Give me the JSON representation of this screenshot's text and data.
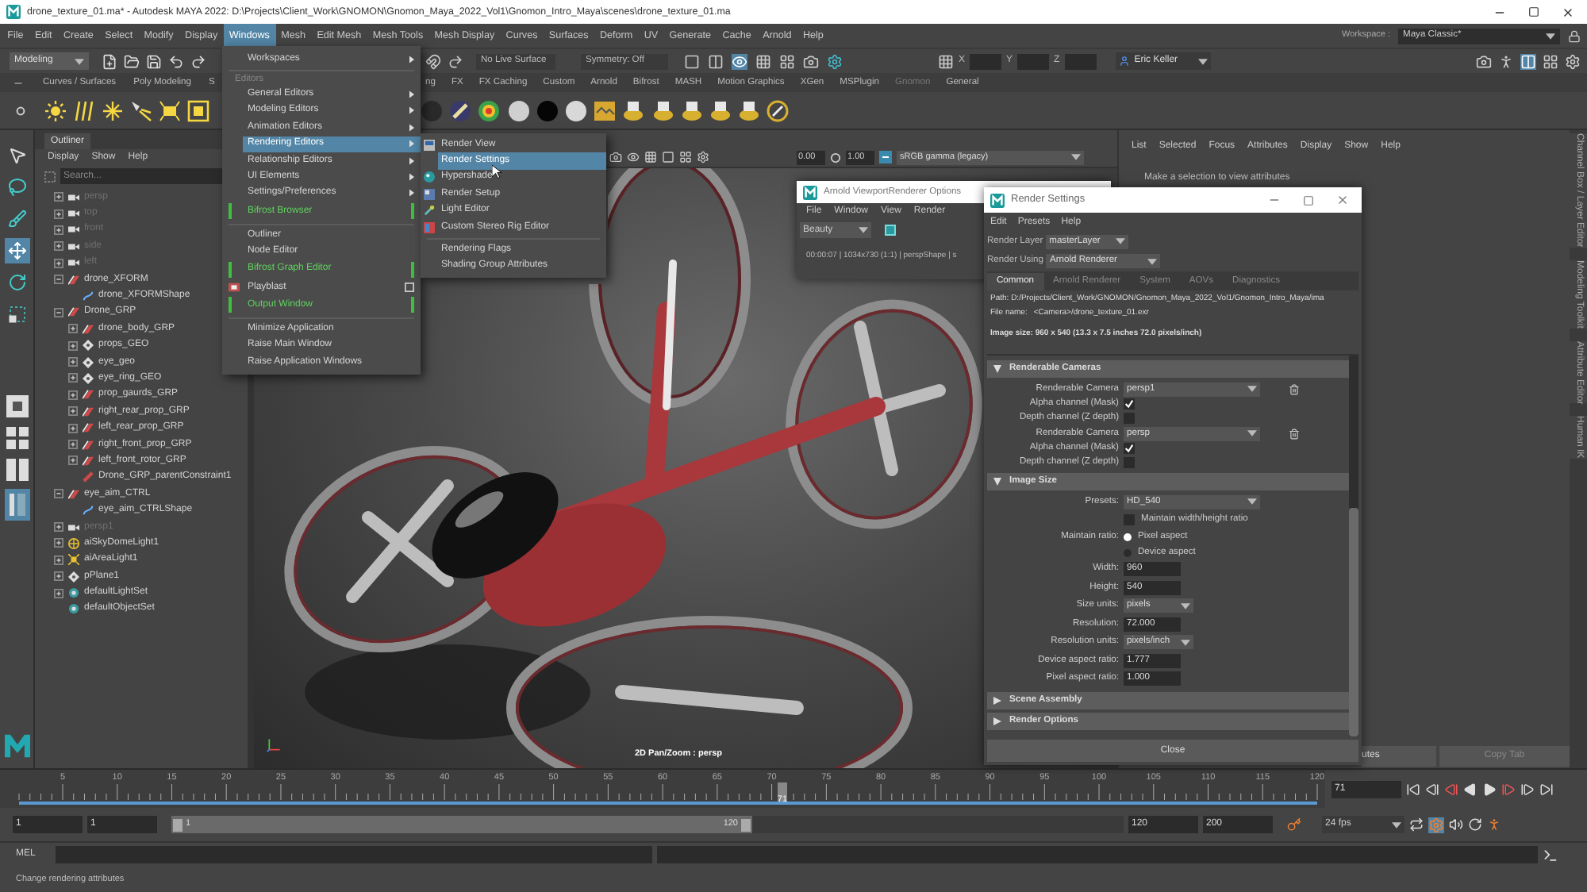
{
  "window": {
    "title": "drone_texture_01.ma* - Autodesk MAYA 2022: D:\\Projects\\Client_Work\\GNOMON\\Gnomon_Maya_2022_Vol1\\Gnomon_Intro_Maya\\scenes\\drone_texture_01.ma"
  },
  "menu_bar": [
    {
      "label": "File",
      "selected": false
    },
    {
      "label": "Edit",
      "selected": false
    },
    {
      "label": "Create",
      "selected": false
    },
    {
      "label": "Select",
      "selected": false
    },
    {
      "label": "Modify",
      "selected": false
    },
    {
      "label": "Display",
      "selected": false
    },
    {
      "label": "Windows",
      "selected": true
    },
    {
      "label": "Mesh",
      "selected": false
    },
    {
      "label": "Edit Mesh",
      "selected": false
    },
    {
      "label": "Mesh Tools",
      "selected": false
    },
    {
      "label": "Mesh Display",
      "selected": false
    },
    {
      "label": "Curves",
      "selected": false
    },
    {
      "label": "Surfaces",
      "selected": false
    },
    {
      "label": "Deform",
      "selected": false
    },
    {
      "label": "UV",
      "selected": false
    },
    {
      "label": "Generate",
      "selected": false
    },
    {
      "label": "Cache",
      "selected": false
    },
    {
      "label": "Arnold",
      "selected": false
    },
    {
      "label": "Help",
      "selected": false
    }
  ],
  "workspace": {
    "label": "Workspace :",
    "value": "Maya Classic*"
  },
  "status_line": {
    "menu_set": "Modeling",
    "live_surface": "No Live Surface",
    "symmetry": "Symmetry: Off",
    "coordinates": [
      "X",
      "Y",
      "Z"
    ],
    "user": "Eric Keller"
  },
  "shelf_tabs": [
    {
      "label": "Curves / Surfaces",
      "disabled": false
    },
    {
      "label": "Poly Modeling",
      "disabled": false
    },
    {
      "label": "S",
      "disabled": false
    },
    {
      "label": "ng",
      "disabled": false
    },
    {
      "label": "FX",
      "disabled": false
    },
    {
      "label": "FX Caching",
      "disabled": false
    },
    {
      "label": "Custom",
      "disabled": false
    },
    {
      "label": "Arnold",
      "disabled": false
    },
    {
      "label": "Bifrost",
      "disabled": false
    },
    {
      "label": "MASH",
      "disabled": false
    },
    {
      "label": "Motion Graphics",
      "disabled": false
    },
    {
      "label": "XGen",
      "disabled": false
    },
    {
      "label": "MSPlugin",
      "disabled": false
    },
    {
      "label": "Gnomon",
      "disabled": true
    },
    {
      "label": "General",
      "disabled": false
    }
  ],
  "outliner": {
    "title": "Outliner",
    "menu": [
      "Display",
      "Show",
      "Help"
    ],
    "search": {
      "placeholder": "Search..."
    },
    "items": [
      {
        "label": "persp",
        "kind": "camera",
        "dimmed": true,
        "expanded": false
      },
      {
        "label": "top",
        "kind": "camera",
        "dimmed": true,
        "expanded": false
      },
      {
        "label": "front",
        "kind": "camera",
        "dimmed": true,
        "expanded": false
      },
      {
        "label": "side",
        "kind": "camera",
        "dimmed": true,
        "expanded": false
      },
      {
        "label": "left",
        "kind": "camera",
        "dimmed": true,
        "expanded": false
      },
      {
        "label": "drone_XFORM",
        "kind": "group",
        "dimmed": false,
        "expanded": true,
        "children": [
          {
            "label": "drone_XFORMShape",
            "kind": "curve",
            "dimmed": false
          }
        ]
      },
      {
        "label": "Drone_GRP",
        "kind": "group",
        "dimmed": false,
        "expanded": true,
        "children": [
          {
            "label": "drone_body_GRP",
            "kind": "group",
            "dimmed": false,
            "expanded": false
          },
          {
            "label": "props_GEO",
            "kind": "mesh",
            "dimmed": false,
            "expanded": false
          },
          {
            "label": "eye_geo",
            "kind": "mesh",
            "dimmed": false,
            "expanded": false
          },
          {
            "label": "eye_ring_GEO",
            "kind": "mesh",
            "dimmed": false,
            "expanded": false
          },
          {
            "label": "prop_gaurds_GRP",
            "kind": "group",
            "dimmed": false,
            "expanded": false
          },
          {
            "label": "right_rear_prop_GRP",
            "kind": "group",
            "dimmed": false,
            "expanded": false
          },
          {
            "label": "left_rear_prop_GRP",
            "kind": "group",
            "dimmed": false,
            "expanded": false
          },
          {
            "label": "right_front_prop_GRP",
            "kind": "group",
            "dimmed": false,
            "expanded": false
          },
          {
            "label": "left_front_rotor_GRP",
            "kind": "group",
            "dimmed": false,
            "expanded": false
          },
          {
            "label": "Drone_GRP_parentConstraint1",
            "kind": "constraint",
            "dimmed": false
          }
        ]
      },
      {
        "label": "eye_aim_CTRL",
        "kind": "group",
        "dimmed": false,
        "expanded": true,
        "children": [
          {
            "label": "eye_aim_CTRLShape",
            "kind": "curve",
            "dimmed": false
          }
        ]
      },
      {
        "label": "persp1",
        "kind": "camera",
        "dimmed": true,
        "expanded": false
      },
      {
        "label": "aiSkyDomeLight1",
        "kind": "skydome",
        "dimmed": false,
        "expanded": false
      },
      {
        "label": "aiAreaLight1",
        "kind": "area_light",
        "dimmed": false,
        "expanded": false
      },
      {
        "label": "pPlane1",
        "kind": "mesh",
        "dimmed": false,
        "expanded": false
      },
      {
        "label": "defaultLightSet",
        "kind": "set",
        "dimmed": false,
        "expanded": false
      },
      {
        "label": "defaultObjectSet",
        "kind": "set",
        "dimmed": false
      }
    ]
  },
  "windows_menu": {
    "items": [
      {
        "kind": "item",
        "label": "Workspaces",
        "submenu": true,
        "selected": false
      },
      {
        "kind": "separator"
      },
      {
        "kind": "header",
        "label": "Editors"
      },
      {
        "kind": "item",
        "label": "General Editors",
        "submenu": true,
        "selected": false
      },
      {
        "kind": "item",
        "label": "Modeling Editors",
        "submenu": true,
        "selected": false
      },
      {
        "kind": "item",
        "label": "Animation Editors",
        "submenu": true,
        "selected": false
      },
      {
        "kind": "item",
        "label": "Rendering Editors",
        "submenu": true,
        "selected": true
      },
      {
        "kind": "item",
        "label": "Relationship Editors",
        "submenu": true,
        "selected": false
      },
      {
        "kind": "item",
        "label": "UI Elements",
        "submenu": true,
        "selected": false
      },
      {
        "kind": "item",
        "label": "Settings/Preferences",
        "submenu": true,
        "selected": false
      },
      {
        "kind": "bracketed",
        "label": "Bifrost Browser",
        "selected": false
      },
      {
        "kind": "separator"
      },
      {
        "kind": "item",
        "label": "Outliner",
        "submenu": false,
        "selected": false
      },
      {
        "kind": "item",
        "label": "Node Editor",
        "submenu": false,
        "selected": false
      },
      {
        "kind": "bracketed",
        "label": "Bifrost Graph Editor",
        "selected": false
      },
      {
        "kind": "option_item",
        "label": "Playblast",
        "selected": false
      },
      {
        "kind": "bracketed",
        "label": "Output Window",
        "selected": false
      },
      {
        "kind": "separator"
      },
      {
        "kind": "item",
        "label": "Minimize Application",
        "submenu": false,
        "selected": false
      },
      {
        "kind": "item",
        "label": "Raise Main Window",
        "submenu": false,
        "selected": false
      },
      {
        "kind": "item",
        "label": "Raise Application Windows",
        "submenu": false,
        "selected": false
      }
    ]
  },
  "rendering_editors_submenu": {
    "items": [
      {
        "kind": "item",
        "label": "Render View",
        "selected": false
      },
      {
        "kind": "item",
        "label": "Render Settings",
        "selected": true
      },
      {
        "kind": "item",
        "label": "Hypershade",
        "selected": false
      },
      {
        "kind": "item",
        "label": "Render Setup",
        "selected": false
      },
      {
        "kind": "item",
        "label": "Light Editor",
        "selected": false
      },
      {
        "kind": "item",
        "label": "Custom Stereo Rig Editor",
        "selected": false
      },
      {
        "kind": "separator"
      },
      {
        "kind": "item",
        "label": "Rendering Flags",
        "selected": false
      },
      {
        "kind": "item",
        "label": "Shading Group Attributes",
        "selected": false
      }
    ]
  },
  "viewport": {
    "exposure": "0.00",
    "gamma": "1.00",
    "color_space": "sRGB gamma (legacy)",
    "camera_label": "2D Pan/Zoom : persp"
  },
  "arnold_viewport_window": {
    "title": "Arnold ViewportRenderer Options",
    "menu": [
      "File",
      "Window",
      "View",
      "Render"
    ],
    "aov": "Beauty",
    "status": "00:00:07 | 1034x730 (1:1) | perspShape | s"
  },
  "render_settings": {
    "title": "Render Settings",
    "menu": [
      "Edit",
      "Presets",
      "Help"
    ],
    "render_layer": {
      "label": "Render Layer",
      "value": "masterLayer"
    },
    "render_using": {
      "label": "Render Using",
      "value": "Arnold Renderer"
    },
    "tabs": [
      {
        "label": "Common",
        "selected": true
      },
      {
        "label": "Arnold Renderer",
        "selected": false
      },
      {
        "label": "System",
        "selected": false
      },
      {
        "label": "AOVs",
        "selected": false
      },
      {
        "label": "Diagnostics",
        "selected": false
      }
    ],
    "path": "Path: D:/Projects/Client_Work/GNOMON/Gnomon_Maya_2022_Vol1/Gnomon_Intro_Maya/ima",
    "file_name": {
      "label": "File name:",
      "value": "<Camera>/drone_texture_01.exr"
    },
    "image_size": "Image size: 960 x 540 (13.3 x 7.5 inches 72.0 pixels/inch)",
    "sections": [
      {
        "title": "Renderable Cameras",
        "expanded": true,
        "rows": [
          {
            "kind": "camera",
            "label": "Renderable Camera",
            "value": "persp1"
          },
          {
            "kind": "checkbox",
            "label": "Alpha channel (Mask)",
            "checked": true
          },
          {
            "kind": "checkbox",
            "label": "Depth channel (Z depth)",
            "checked": false
          },
          {
            "kind": "camera",
            "label": "Renderable Camera",
            "value": "persp"
          },
          {
            "kind": "checkbox",
            "label": "Alpha channel (Mask)",
            "checked": true
          },
          {
            "kind": "checkbox",
            "label": "Depth channel (Z depth)",
            "checked": false
          }
        ]
      },
      {
        "title": "Image Size",
        "expanded": true,
        "rows": [
          {
            "kind": "dropdown",
            "label": "Presets:",
            "value": "HD_540"
          },
          {
            "kind": "check_option",
            "text": "Maintain width/height ratio",
            "checked": false
          },
          {
            "kind": "radio",
            "label": "Maintain ratio:",
            "options": [
              {
                "label": "Pixel aspect",
                "selected": true
              },
              {
                "label": "Device aspect",
                "selected": false
              }
            ]
          },
          {
            "kind": "field",
            "label": "Width:",
            "value": "960"
          },
          {
            "kind": "field",
            "label": "Height:",
            "value": "540"
          },
          {
            "kind": "dropdown",
            "label": "Size units:",
            "value": "pixels"
          },
          {
            "kind": "field",
            "label": "Resolution:",
            "value": "72.000"
          },
          {
            "kind": "dropdown",
            "label": "Resolution units:",
            "value": "pixels/inch"
          },
          {
            "kind": "field",
            "label": "Device aspect ratio:",
            "value": "1.777"
          },
          {
            "kind": "field",
            "label": "Pixel aspect ratio:",
            "value": "1.000"
          }
        ]
      },
      {
        "title": "Scene Assembly",
        "expanded": false
      },
      {
        "title": "Render Options",
        "expanded": false
      }
    ],
    "close_button": "Close"
  },
  "attribute_editor": {
    "menu": [
      "List",
      "Selected",
      "Focus",
      "Attributes",
      "Display",
      "Show",
      "Help"
    ],
    "message": "Make a selection to view attributes",
    "buttons": [
      {
        "label": "utes",
        "disabled": false
      },
      {
        "label": "Copy Tab",
        "disabled": true
      }
    ]
  },
  "side_tabs": [
    "Channel Box / Layer Editor",
    "Modeling Toolkit",
    "Attribute Editor",
    "Human IK"
  ],
  "timeline": {
    "ticks": [
      "5",
      "10",
      "15",
      "20",
      "25",
      "30",
      "35",
      "40",
      "45",
      "50",
      "55",
      "60",
      "65",
      "70",
      "75",
      "80",
      "85",
      "90",
      "95",
      "100",
      "105",
      "110",
      "115",
      "120"
    ],
    "current_frame": "71",
    "level": 0.588,
    "frame_field": "71"
  },
  "range_slider": {
    "start": "1",
    "playback_start": "1",
    "bar_start": "1",
    "bar_end": "120",
    "level": 0.61,
    "playback_end": "120",
    "end": "200",
    "fps": "24 fps"
  },
  "command_line": {
    "language": "MEL"
  },
  "help_line": "Change rendering attributes"
}
